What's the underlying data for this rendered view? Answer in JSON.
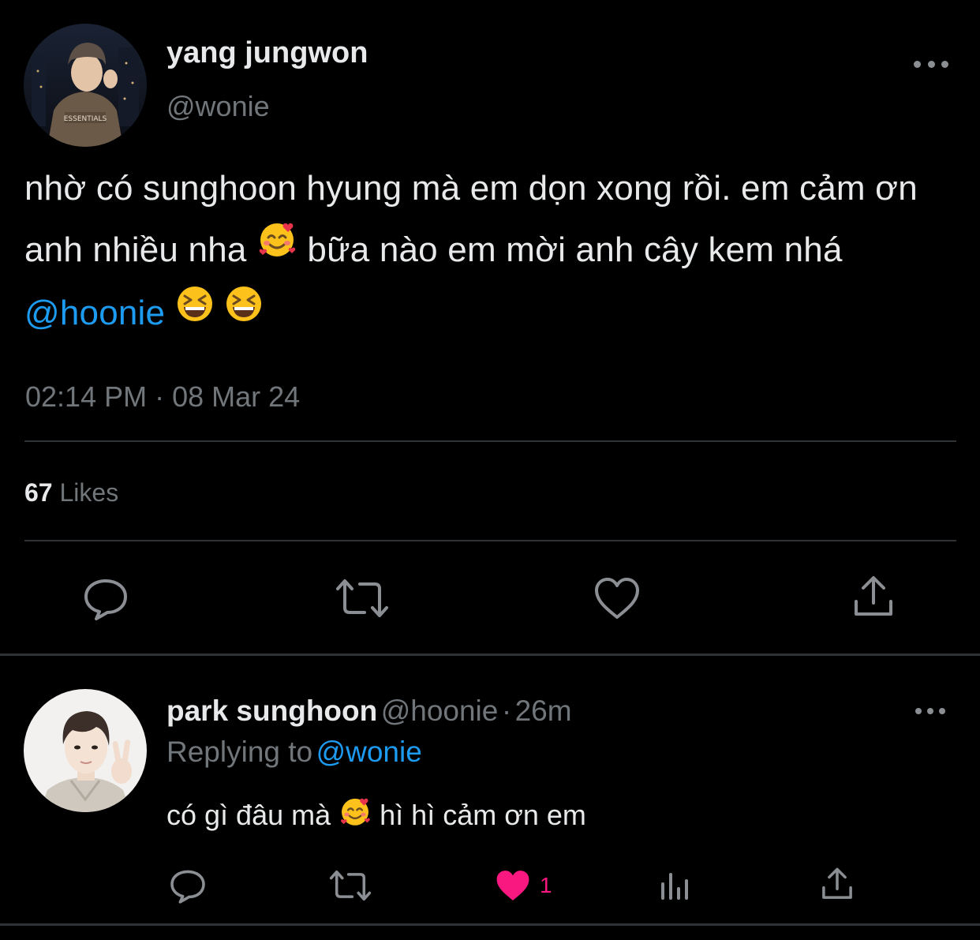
{
  "main_tweet": {
    "display_name": "yang jungwon",
    "handle": "@wonie",
    "text_part1": "nhờ có sunghoon hyung mà em dọn xong rồi. em cảm ơn anh nhiều nha",
    "text_part2": "bữa nào em mời anh cây kem nhá",
    "mention": "@hoonie",
    "timestamp": "02:14 PM · 08 Mar 24",
    "likes_count": "67",
    "likes_label": "Likes",
    "icons": [
      "more-icon",
      "reply-icon",
      "retweet-icon",
      "like-icon",
      "share-icon"
    ]
  },
  "reply_tweet": {
    "display_name": "park sunghoon",
    "handle": "@hoonie",
    "time_ago": "26m",
    "replying_to_label": "Replying to",
    "replying_to_handle": "@wonie",
    "text_part1": "có gì đâu mà",
    "text_part2": "hì hì cảm ơn em",
    "like_count": "1",
    "icons": [
      "more-icon",
      "reply-icon",
      "retweet-icon",
      "liked-heart-icon",
      "views-icon",
      "share-icon"
    ]
  },
  "colors": {
    "background": "#000000",
    "text": "#e7e9ea",
    "secondary": "#71767b",
    "accent": "#1d9bf0",
    "like": "#f91880",
    "divider": "#2f3336"
  }
}
